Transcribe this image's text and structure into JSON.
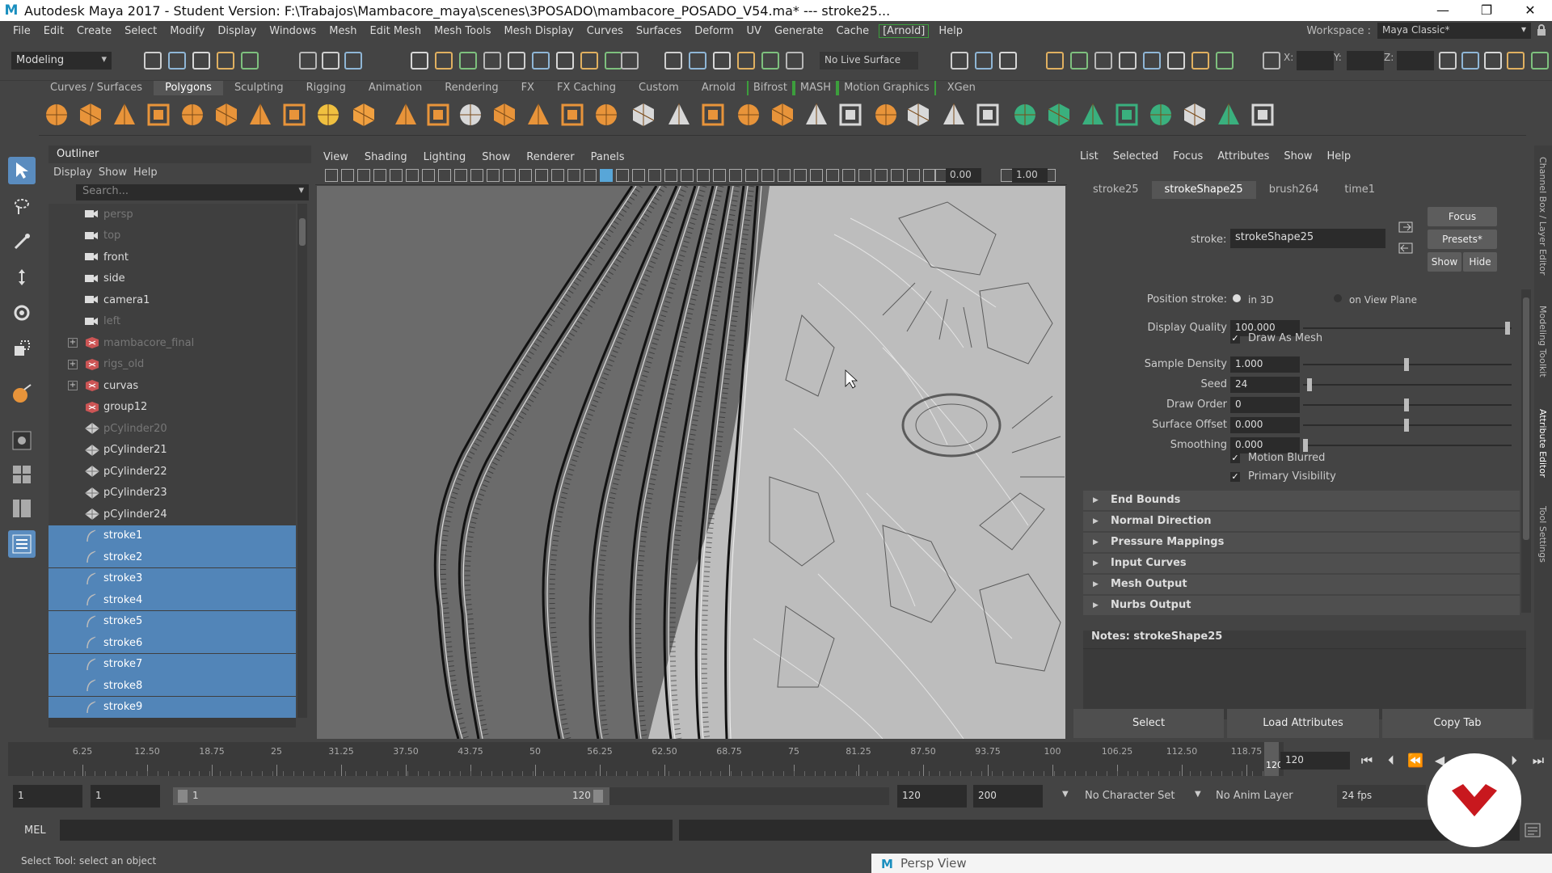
{
  "window": {
    "title": "Autodesk Maya 2017 - Student Version: F:\\Trabajos\\Mambacore_maya\\scenes\\3POSADO\\mambacore_POSADO_V54.ma*   ---   stroke25...",
    "controls": [
      "—",
      "❐",
      "✕"
    ]
  },
  "menubar": {
    "items": [
      "File",
      "Edit",
      "Create",
      "Select",
      "Modify",
      "Display",
      "Windows",
      "Mesh",
      "Edit Mesh",
      "Mesh Tools",
      "Mesh Display",
      "Curves",
      "Surfaces",
      "Deform",
      "UV",
      "Generate",
      "Cache",
      "[Arnold]",
      "Help"
    ],
    "workspace_label": "Workspace :",
    "workspace_value": "Maya Classic*"
  },
  "statusline": {
    "menuset": "Modeling",
    "live_surface": "No Live Surface",
    "x_label": "X:",
    "y_label": "Y:",
    "z_label": "Z:"
  },
  "shelf": {
    "tabs": [
      "Curves / Surfaces",
      "Polygons",
      "Sculpting",
      "Rigging",
      "Animation",
      "Rendering",
      "FX",
      "FX Caching",
      "Custom",
      "Arnold",
      "Bifrost",
      "MASH",
      "Motion Graphics",
      "XGen"
    ],
    "active_tab": "Polygons"
  },
  "outliner": {
    "title": "Outliner",
    "menu": [
      "Display",
      "Show",
      "Help"
    ],
    "search_placeholder": "Search...",
    "items": [
      {
        "name": "persp",
        "icon": "camera-icon",
        "dim": true,
        "sel": false,
        "exp": false
      },
      {
        "name": "top",
        "icon": "camera-icon",
        "dim": true,
        "sel": false,
        "exp": false
      },
      {
        "name": "front",
        "icon": "camera-icon",
        "dim": false,
        "sel": false,
        "exp": false
      },
      {
        "name": "side",
        "icon": "camera-icon",
        "dim": false,
        "sel": false,
        "exp": false
      },
      {
        "name": "camera1",
        "icon": "camera-icon",
        "dim": false,
        "sel": false,
        "exp": false
      },
      {
        "name": "left",
        "icon": "camera-icon",
        "dim": true,
        "sel": false,
        "exp": false
      },
      {
        "name": "mambacore_final",
        "icon": "group-icon",
        "dim": true,
        "sel": false,
        "exp": true
      },
      {
        "name": "rigs_old",
        "icon": "group-icon",
        "dim": true,
        "sel": false,
        "exp": true
      },
      {
        "name": "curvas",
        "icon": "group-icon",
        "dim": false,
        "sel": false,
        "exp": true
      },
      {
        "name": "group12",
        "icon": "group-icon",
        "dim": false,
        "sel": false,
        "exp": false
      },
      {
        "name": "pCylinder20",
        "icon": "mesh-icon",
        "dim": true,
        "sel": false,
        "exp": false
      },
      {
        "name": "pCylinder21",
        "icon": "mesh-icon",
        "dim": false,
        "sel": false,
        "exp": false
      },
      {
        "name": "pCylinder22",
        "icon": "mesh-icon",
        "dim": false,
        "sel": false,
        "exp": false
      },
      {
        "name": "pCylinder23",
        "icon": "mesh-icon",
        "dim": false,
        "sel": false,
        "exp": false
      },
      {
        "name": "pCylinder24",
        "icon": "mesh-icon",
        "dim": false,
        "sel": false,
        "exp": false
      },
      {
        "name": "stroke1",
        "icon": "stroke-icon",
        "dim": false,
        "sel": true,
        "exp": false
      },
      {
        "name": "stroke2",
        "icon": "stroke-icon",
        "dim": false,
        "sel": true,
        "exp": false
      },
      {
        "name": "stroke3",
        "icon": "stroke-icon",
        "dim": false,
        "sel": true,
        "exp": false
      },
      {
        "name": "stroke4",
        "icon": "stroke-icon",
        "dim": false,
        "sel": true,
        "exp": false
      },
      {
        "name": "stroke5",
        "icon": "stroke-icon",
        "dim": false,
        "sel": true,
        "exp": false
      },
      {
        "name": "stroke6",
        "icon": "stroke-icon",
        "dim": false,
        "sel": true,
        "exp": false
      },
      {
        "name": "stroke7",
        "icon": "stroke-icon",
        "dim": false,
        "sel": true,
        "exp": false
      },
      {
        "name": "stroke8",
        "icon": "stroke-icon",
        "dim": false,
        "sel": true,
        "exp": false
      },
      {
        "name": "stroke9",
        "icon": "stroke-icon",
        "dim": false,
        "sel": true,
        "exp": false
      }
    ]
  },
  "viewport": {
    "menu": [
      "View",
      "Shading",
      "Lighting",
      "Show",
      "Renderer",
      "Panels"
    ],
    "exposure": "0.00",
    "gamma": "1.00"
  },
  "attribute_editor": {
    "menu": [
      "List",
      "Selected",
      "Focus",
      "Attributes",
      "Show",
      "Help"
    ],
    "tabs": [
      "stroke25",
      "strokeShape25",
      "brush264",
      "time1"
    ],
    "active_tab": "strokeShape25",
    "stroke_label": "stroke:",
    "stroke_value": "strokeShape25",
    "focus_button": "Focus",
    "presets_button": "Presets*",
    "show_button": "Show",
    "hide_button": "Hide",
    "position_stroke_label": "Position stroke:",
    "position_in_3d": "in 3D",
    "position_on_view_plane": "on View Plane",
    "attributes": [
      {
        "label": "Display Quality",
        "value": "100.000",
        "slider": 1.0
      },
      {
        "label": "Sample Density",
        "value": "1.000",
        "slider": 0.5
      },
      {
        "label": "Seed",
        "value": "24",
        "slider": 0.02
      },
      {
        "label": "Draw Order",
        "value": "0",
        "slider": 0.5
      },
      {
        "label": "Surface Offset",
        "value": "0.000",
        "slider": 0.5
      },
      {
        "label": "Smoothing",
        "value": "0.000",
        "slider": 0.0
      }
    ],
    "draw_as_mesh": "Draw As Mesh",
    "motion_blurred": "Motion Blurred",
    "primary_visibility": "Primary Visibility",
    "sections": [
      "End Bounds",
      "Normal Direction",
      "Pressure Mappings",
      "Input Curves",
      "Mesh Output",
      "Nurbs Output"
    ],
    "notes_label": "Notes:  strokeShape25",
    "bottom_buttons": [
      "Select",
      "Load Attributes",
      "Copy Tab"
    ],
    "side_tabs": [
      "Channel Box / Layer Editor",
      "Modeling Toolkit",
      "Attribute Editor",
      "Tool Settings"
    ]
  },
  "timeline": {
    "ticks": [
      "6.25",
      "12.50",
      "18.75",
      "25",
      "31.25",
      "37.50",
      "43.75",
      "50",
      "56.25",
      "62.50",
      "68.75",
      "75",
      "81.25",
      "87.50",
      "93.75",
      "100",
      "106.25",
      "112.50",
      "118.75"
    ],
    "end_marker": "120",
    "current_frame": "120"
  },
  "range": {
    "start": "1",
    "playback_start": "1",
    "slider_start": "1",
    "slider_end": "120",
    "playback_end": "120",
    "end": "200",
    "character_set": "No Character Set",
    "anim_layer": "No Anim Layer",
    "fps": "24 fps"
  },
  "commandline": {
    "label": "MEL",
    "help_text": "Select Tool: select an object"
  },
  "taskbar": {
    "persp_view": "Persp View"
  }
}
